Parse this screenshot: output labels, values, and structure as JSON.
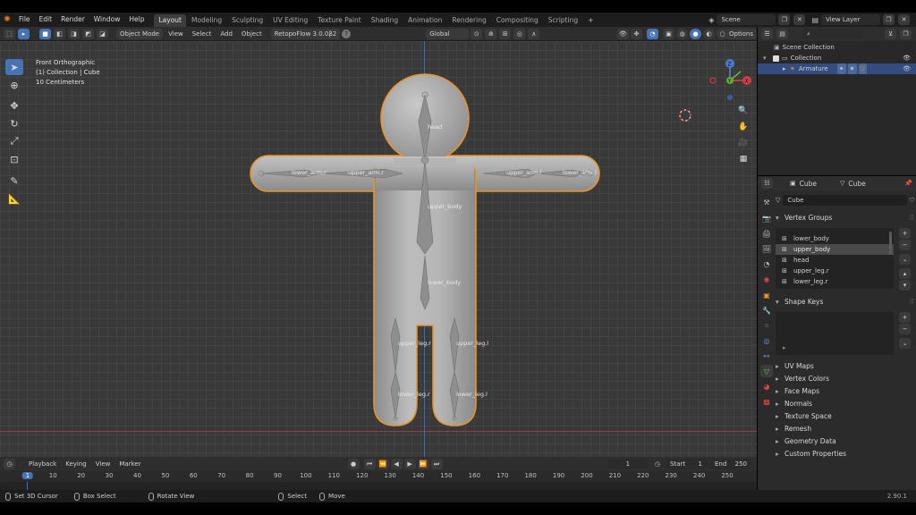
{
  "topbar": {
    "menus": [
      "File",
      "Edit",
      "Render",
      "Window",
      "Help"
    ],
    "tabs": [
      "Layout",
      "Modeling",
      "Sculpting",
      "UV Editing",
      "Texture Paint",
      "Shading",
      "Animation",
      "Rendering",
      "Compositing",
      "Scripting"
    ],
    "active_tab": "Layout",
    "add_tab": "+",
    "scene": "Scene",
    "view_layer": "View Layer"
  },
  "viewport_header": {
    "mode": "Object Mode",
    "menus": [
      "View",
      "Select",
      "Add",
      "Object"
    ],
    "addon": "RetopoFlow 3.0.0β2",
    "orientation": "Global",
    "options": "Options"
  },
  "viewport": {
    "overlay_lines": [
      "Front Orthographic",
      "(1) Collection | Cube",
      "10 Centimeters"
    ],
    "bones": {
      "head": "head",
      "lower_arm_r": "lower_arm.r",
      "upper_arm_r": "upper_arm.r",
      "upper_arm_l": "upper_arm.l",
      "lower_arm_l": "lower_arm.l",
      "upper_body_1": "upper_body",
      "upper_body_2": "lower_body",
      "upper_leg_r": "upper_leg.r",
      "upper_leg_l": "upper_leg.l",
      "lower_leg_r": "lower_leg.r",
      "lower_leg_l": "lower_leg.l"
    },
    "gizmo": {
      "z": "Z",
      "y": "Y",
      "x": "X"
    }
  },
  "outliner": {
    "scene_collection": "Scene Collection",
    "collection": "Collection",
    "armature": "Armature"
  },
  "properties": {
    "object_name": "Cube",
    "data_name": "Cube",
    "mesh_field": "Cube",
    "vertex_groups_title": "Vertex Groups",
    "vertex_groups": [
      "lower_body",
      "upper_body",
      "head",
      "upper_leg.r",
      "lower_leg.r"
    ],
    "selected_group": "upper_body",
    "shape_keys_title": "Shape Keys",
    "collapsed_panels": [
      "UV Maps",
      "Vertex Colors",
      "Face Maps",
      "Normals",
      "Texture Space",
      "Remesh",
      "Geometry Data",
      "Custom Properties"
    ]
  },
  "timeline": {
    "menus": [
      "Playback",
      "Keying",
      "View",
      "Marker"
    ],
    "current_frame": "1",
    "start_label": "Start",
    "start": "1",
    "end_label": "End",
    "end": "250",
    "ticks": [
      "1",
      "10",
      "20",
      "30",
      "40",
      "50",
      "60",
      "70",
      "80",
      "90",
      "100",
      "110",
      "120",
      "130",
      "140",
      "150",
      "160",
      "170",
      "180",
      "190",
      "200",
      "210",
      "220",
      "230",
      "240",
      "250"
    ]
  },
  "statusbar": {
    "items": [
      "Set 3D Cursor",
      "Box Select",
      "Rotate View",
      "Select",
      "Move"
    ],
    "version": "2.90.1"
  },
  "colors": {
    "accent": "#4772b3",
    "selection_outline": "#e8932b",
    "outliner_selected": "#334d80"
  }
}
